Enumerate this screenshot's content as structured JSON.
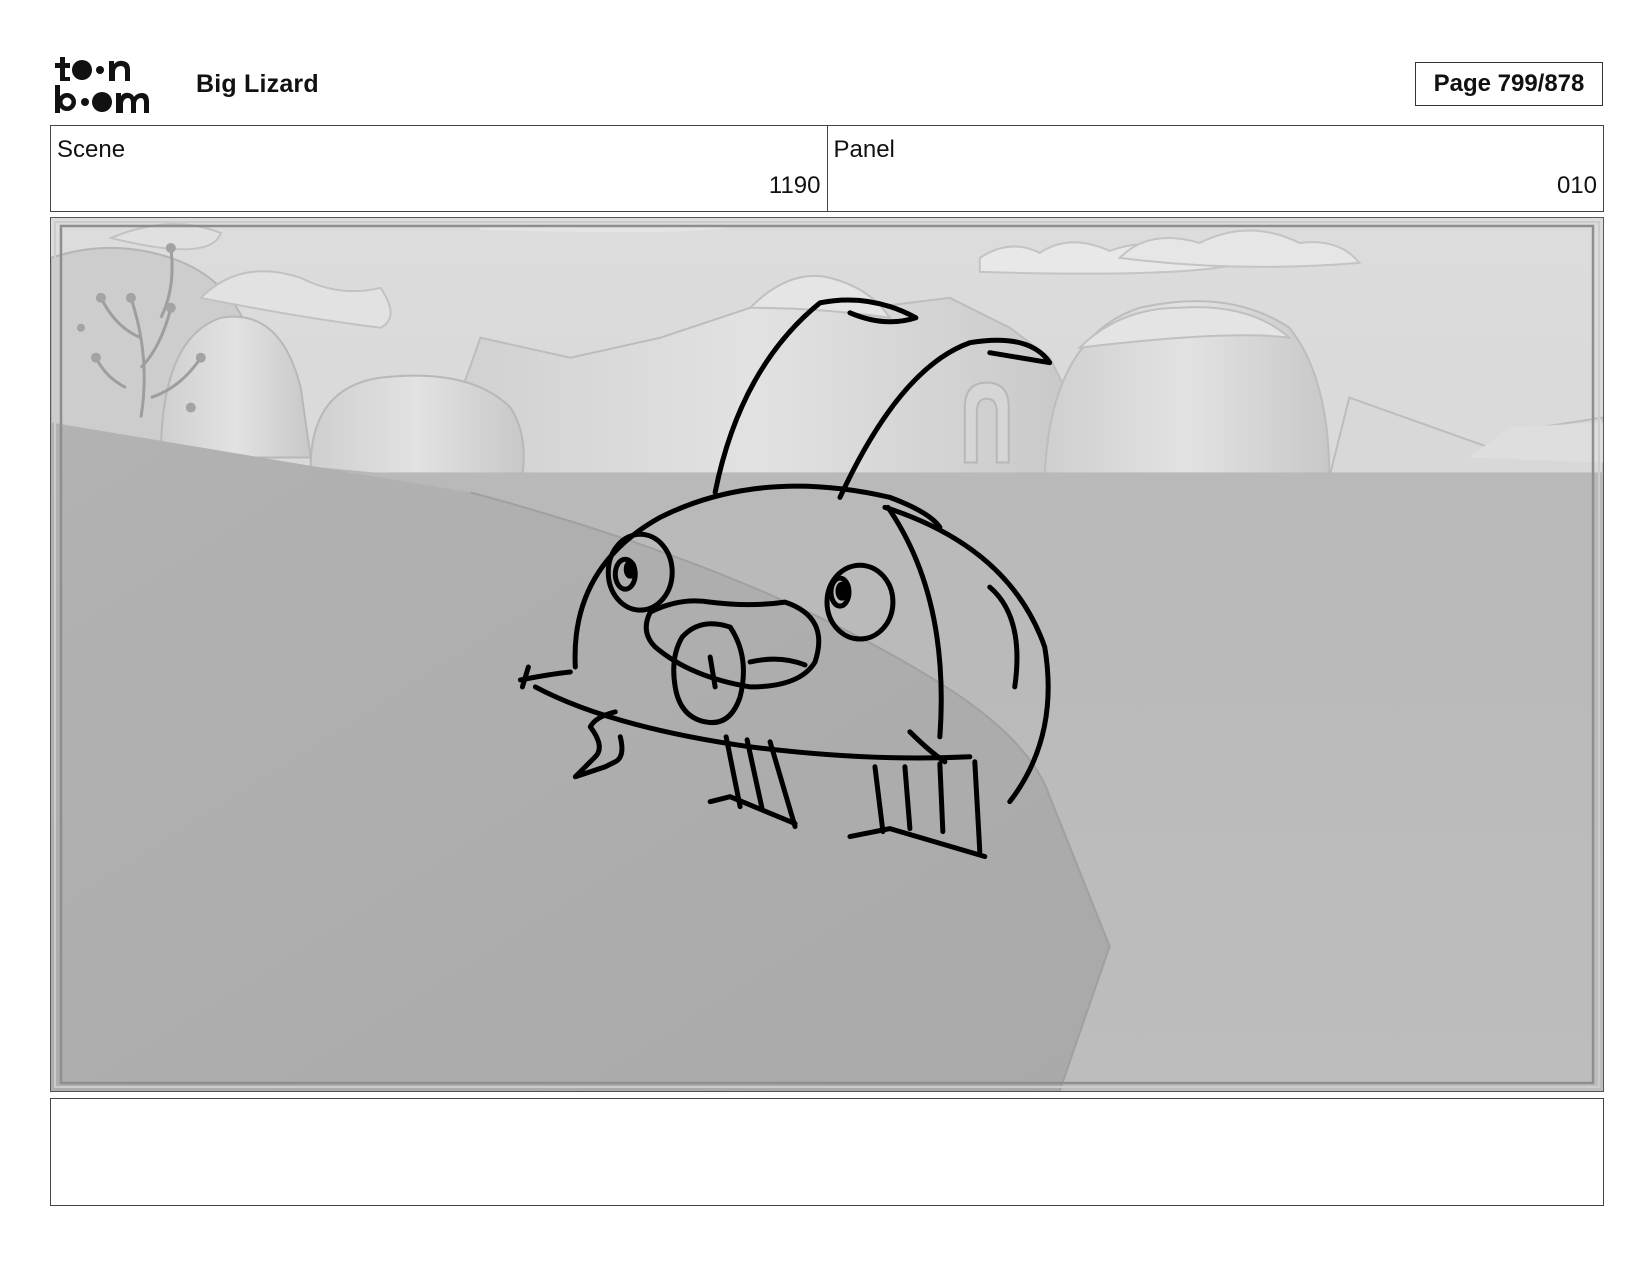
{
  "header": {
    "logo_text": "toonboom",
    "project_title": "Big Lizard",
    "page_label": "Page 799/878"
  },
  "meta": {
    "scene_label": "Scene",
    "scene_value": "1190",
    "panel_label": "Panel",
    "panel_value": "010"
  },
  "panel_image": {
    "subject": "bug-sketch",
    "background": "grayscale-3d-landscape"
  },
  "notes": {
    "text": ""
  }
}
